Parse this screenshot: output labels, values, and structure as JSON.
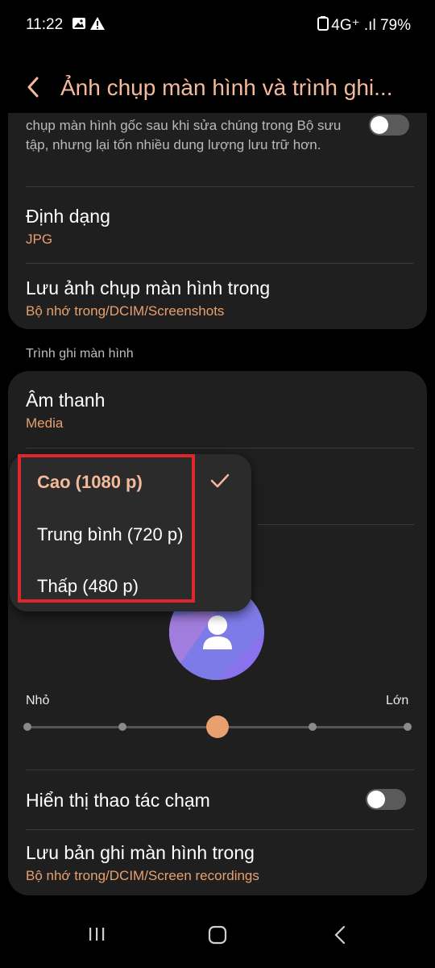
{
  "status_bar": {
    "time": "11:22",
    "right_text": "4G⁺ .ıl 79%"
  },
  "header": {
    "title": "Ảnh chụp màn hình và trình ghi..."
  },
  "screenshot_settings": {
    "description": "chụp màn hình gốc sau khi sửa chúng trong Bộ sưu tập, nhưng lại tốn nhiều dung lượng lưu trữ hơn.",
    "format_label": "Định dạng",
    "format_value": "JPG",
    "save_location_label": "Lưu ảnh chụp màn hình trong",
    "save_location_value": "Bộ nhớ trong/DCIM/Screenshots"
  },
  "screen_recorder": {
    "section_title": "Trình ghi màn hình",
    "sound_label": "Âm thanh",
    "sound_value": "Media",
    "size_min_label": "Nhỏ",
    "size_max_label": "Lớn",
    "size_level": {
      "value": 3,
      "max": 5
    },
    "show_touches_label": "Hiển thị thao tác chạm",
    "save_location_label": "Lưu bản ghi màn hình trong",
    "save_location_value": "Bộ nhớ trong/DCIM/Screen recordings"
  },
  "quality_dropdown": {
    "options": [
      {
        "label": "Cao (1080 p)",
        "selected": true
      },
      {
        "label": "Trung bình (720 p)",
        "selected": false
      },
      {
        "label": "Thấp (480 p)",
        "selected": false
      }
    ]
  },
  "colors": {
    "accent": "#e8a06e",
    "title": "#f5b99c",
    "highlight": "#e0262a"
  }
}
